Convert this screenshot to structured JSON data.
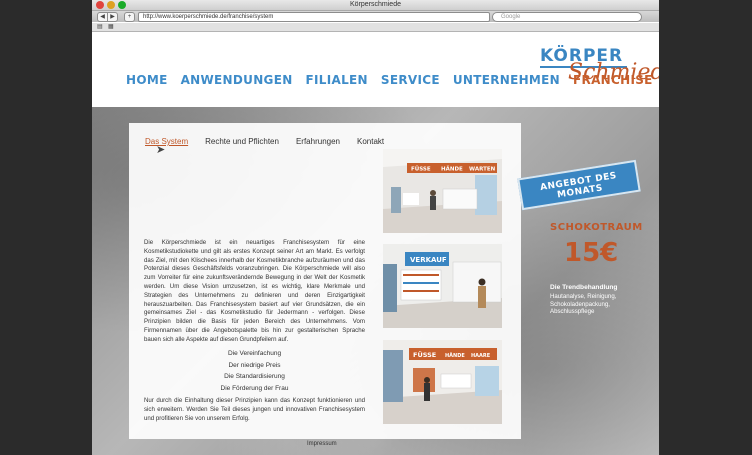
{
  "window": {
    "title": "Körperschmiede",
    "url": "http://www.koerperschmiede.de/franchise/system",
    "search_placeholder": "Google"
  },
  "colors": {
    "brand_blue": "#3a86c2",
    "brand_orange": "#c0582a"
  },
  "logo": {
    "top": "KÖRPER",
    "bottom": "Schmiede"
  },
  "nav": {
    "items": [
      "HOME",
      "ANWENDUNGEN",
      "FILIALEN",
      "SERVICE",
      "UNTERNEHMEN",
      "FRANCHISE"
    ],
    "active": "FRANCHISE"
  },
  "subnav": {
    "items": [
      "Das System",
      "Rechte und Pflichten",
      "Erfahrungen",
      "Kontakt"
    ],
    "active": "Das System"
  },
  "content": {
    "paragraph1": "Die Körperschmiede ist ein neuartiges Franchisesystem für eine Kosmetikstudiokette und gilt als erstes Konzept seiner Art am Markt. Es verfolgt das Ziel, mit den Klischees innerhalb der Kosmetikbranche aufzuräumen und das Potenzial dieses Geschäftsfelds voranzubringen. Die Körperschmiede will also zum Vorreiter für eine zukunftsverändernde Bewegung in der Welt der Kosmetik werden. Um diese Vision umzusetzen, ist es wichtig, klare Merkmale und Strategien des Unternehmens zu definieren und deren Einzigartigkeit herauszuarbeiten. Das Franchisesystem basiert auf vier Grundsätzen, die ein gemeinsames Ziel - das Kosmetikstudio für Jedermann - verfolgen. Diese Prinzipien bilden die Basis für jeden Bereich des Unternehmens. Vom Firmennamen über die Angebotspalette bis hin zur gestalterischen Sprache bauen sich alle Aspekte auf diesen Grundpfeilern auf.",
    "principles": [
      "Die Vereinfachung",
      "Der niedrige Preis",
      "Die Standardisierung",
      "Die Förderung der Frau"
    ],
    "paragraph2": "Nur durch die Einhaltung dieser Prinzipien kann das Konzept funktionieren und sich erweitern. Werden Sie Teil dieses jungen und innovativen Franchisesystem und profitieren Sie von unserem Erfolg."
  },
  "photos": {
    "photo1_sign": [
      "FÜSSE",
      "HÄNDE",
      "WARTEN"
    ],
    "photo2_sign": "VERKAUF",
    "photo3_sign": [
      "FÜSSE",
      "HÄNDE",
      "HAARE"
    ]
  },
  "offer": {
    "banner": "ANGEBOT DES MONATS",
    "title": "SCHOKOTRAUM",
    "price": "15€",
    "subtitle": "Die Trendbehandlung",
    "description": "Hautanalyse, Reinigung, Schokoladenpackung, Abschlusspflege"
  },
  "footer": {
    "impressum": "Impressum"
  }
}
